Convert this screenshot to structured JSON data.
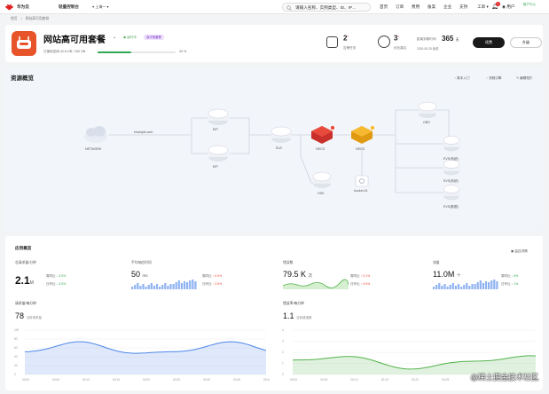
{
  "topbar": {
    "brand": "华为云",
    "console": "轻量控制台",
    "region": "上海一",
    "search_placeholder": "请输入名称、实例类型、ID、IP…",
    "links": [
      "首页",
      "订单",
      "费用",
      "备案",
      "企业",
      "支持"
    ],
    "tool": "工单",
    "msg_count": "1",
    "user": "用户",
    "account": "账户中心"
  },
  "breadcrumb": [
    "首页",
    "/",
    "网站高可用套餐"
  ],
  "header": {
    "title": "网站高可用套餐",
    "status": "运行中",
    "tag": "高可用套餐",
    "storage_label": "已使用空间 42.8 GB / 100 GB",
    "progress": 0.43,
    "pct_label": "43 %",
    "stats": [
      {
        "num": "2",
        "sup": "•",
        "label": "告警任务"
      },
      {
        "num": "3",
        "sup": "•",
        "label": "优化建议"
      },
      {
        "num": "365",
        "unit": "天",
        "label": "距离到期时间",
        "sub": "2026-08-25  续费"
      }
    ],
    "buttons": {
      "primary": "续费",
      "secondary": "升级"
    }
  },
  "overview": {
    "title": "资源概览",
    "actions": [
      "新手入门",
      "流程引擎",
      "编辑拓扑"
    ],
    "nodes": {
      "network": "NETWORK",
      "domain": "example.com",
      "eip1": "EIP",
      "eip2": "EIP",
      "elb": "ELB",
      "ecs1": "HECS",
      "ecs2": "HECS",
      "hss": "HSS",
      "bucket": "bucket-01",
      "obs": "OBS",
      "evs1": "EVS(系统)",
      "evs2": "EVS(系统)",
      "evs3": "EVS(数据)"
    }
  },
  "metrics": {
    "title": "应用概览",
    "action": "监控详情",
    "cards": [
      {
        "title": "总请求量/分钟",
        "value": "2.1",
        "unit": "M",
        "c1": "周同比",
        "v1": "↓ 3.0%",
        "c2": "日环比",
        "v2": "↓ 3.0%"
      },
      {
        "title": "平均响应时间",
        "value": "50",
        "unit": "ms",
        "c1": "周同比",
        "v1": "↑ 0.5%",
        "c2": "日环比",
        "v2": "↑ 3.5%"
      },
      {
        "title": "错误数",
        "value": "79.5 K",
        "unit": "次",
        "c1": "周同比",
        "v1": "↑ 0.1%",
        "c2": "日环比",
        "v2": "↑ 0.5%"
      },
      {
        "title": "流量",
        "value": "11.0M",
        "unit": "个",
        "c1": "周同比",
        "v1": "↓ 5%",
        "c2": "日环比",
        "v2": "↓ 1%"
      }
    ],
    "charts": [
      {
        "title": "请求量/每分钟",
        "value": "78",
        "unit": "当前请求量",
        "yticks": [
          "100",
          "80",
          "60",
          "40",
          "20",
          "0"
        ],
        "xticks": [
          "00:00",
          "00:05",
          "00:10",
          "00:15",
          "00:20",
          "00:25",
          "00:30",
          "00:35",
          "00:40"
        ],
        "color": "#4e86ea"
      },
      {
        "title": "错误率/每分钟",
        "value": "1.1",
        "unit": "当前错误数",
        "yticks": [
          "4",
          "3",
          "2",
          "1",
          "0"
        ],
        "xticks": [
          "00:00",
          "00:05",
          "00:10",
          "00:15",
          "00:20",
          "00:25",
          "00:30",
          "00:35",
          "00:40"
        ],
        "color": "#52b34b"
      }
    ]
  },
  "watermark": "@稀土掘金技术社区"
}
